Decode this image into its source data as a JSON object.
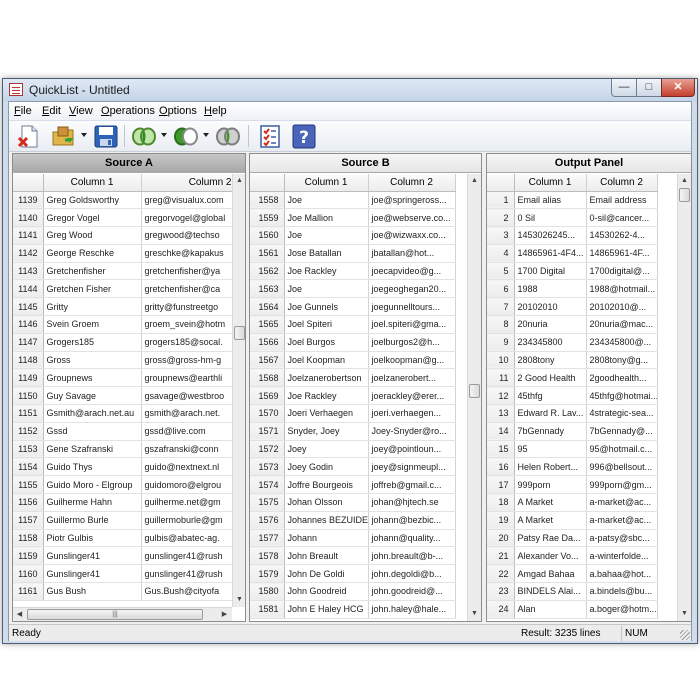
{
  "window": {
    "title": "QuickList - Untitled"
  },
  "menu": [
    {
      "pre": "",
      "u": "F",
      "post": "ile"
    },
    {
      "pre": "",
      "u": "E",
      "post": "dit"
    },
    {
      "pre": "",
      "u": "V",
      "post": "iew"
    },
    {
      "pre": "",
      "u": "O",
      "post": "perations"
    },
    {
      "pre": "",
      "u": "O",
      "post": "ptions"
    },
    {
      "pre": "",
      "u": "H",
      "post": "elp"
    }
  ],
  "toolbar": {
    "icons": [
      "clear-document-icon",
      "open-folder-icon",
      "save-icon",
      "intersect-icon",
      "difference-icon",
      "union-icon",
      "checklist-icon",
      "help-icon"
    ]
  },
  "source_a": {
    "title": "Source A",
    "columns": [
      "Column 1",
      "Column 2"
    ],
    "rows": [
      [
        "1139",
        "Greg Goldsworthy",
        "greg@visualux.com"
      ],
      [
        "1140",
        "Gregor Vogel",
        "gregorvogel@global"
      ],
      [
        "1141",
        "Greg Wood",
        "gregwood@techso"
      ],
      [
        "1142",
        "George Reschke",
        "greschke@kapakus"
      ],
      [
        "1143",
        "Gretchenfisher",
        "gretchenfisher@ya"
      ],
      [
        "1144",
        "Gretchen Fisher",
        "gretchenfisher@ca"
      ],
      [
        "1145",
        "Gritty",
        "gritty@funstreetgo"
      ],
      [
        "1146",
        "Svein Groem",
        "groem_svein@hotm"
      ],
      [
        "1147",
        "Grogers185",
        "grogers185@socal."
      ],
      [
        "1148",
        "Gross",
        "gross@gross-hm-g"
      ],
      [
        "1149",
        "Groupnews",
        "groupnews@earthli"
      ],
      [
        "1150",
        "Guy Savage",
        "gsavage@westbroo"
      ],
      [
        "1151",
        "Gsmith@arach.net.au",
        "gsmith@arach.net."
      ],
      [
        "1152",
        "Gssd",
        "gssd@live.com"
      ],
      [
        "1153",
        "Gene Szafranski",
        "gszafranski@conn"
      ],
      [
        "1154",
        "Guido Thys",
        "guido@nextnext.nl"
      ],
      [
        "1155",
        "Guido Moro - Elgroup",
        "guidomoro@elgrou"
      ],
      [
        "1156",
        "Guilherme Hahn",
        "guilherme.net@gm"
      ],
      [
        "1157",
        "Guillermo Burle",
        "guillermoburle@gm"
      ],
      [
        "1158",
        "Piotr Gulbis",
        "gulbis@abatec-ag."
      ],
      [
        "1159",
        "Gunslinger41",
        "gunslinger41@rush"
      ],
      [
        "1160",
        "Gunslinger41",
        "gunslinger41@rush"
      ],
      [
        "1161",
        "Gus Bush",
        "Gus.Bush@cityofa"
      ]
    ]
  },
  "source_b": {
    "title": "Source B",
    "columns": [
      "Column 1",
      "Column 2"
    ],
    "rows": [
      [
        "1558",
        "Joe",
        "joe@springeross..."
      ],
      [
        "1559",
        "Joe Mallion",
        "joe@webserve.co..."
      ],
      [
        "1560",
        "Joe",
        "joe@wizwaxx.co..."
      ],
      [
        "1561",
        "Jose Batallan",
        "jbatallan@hot..."
      ],
      [
        "1562",
        "Joe Rackley",
        "joecapvideo@g..."
      ],
      [
        "1563",
        "Joe",
        "joegeoghegan20..."
      ],
      [
        "1564",
        "Joe Gunnels",
        "joegunnelltours..."
      ],
      [
        "1565",
        "Joel Spiteri",
        "joel.spiteri@gma..."
      ],
      [
        "1566",
        "Joel Burgos",
        "joelburgos2@h..."
      ],
      [
        "1567",
        "Joel Koopman",
        "joelkoopman@g..."
      ],
      [
        "1568",
        "Joelzanerobertson",
        "joelzanerobert..."
      ],
      [
        "1569",
        "Joe Rackley",
        "joerackley@erer..."
      ],
      [
        "1570",
        "Joeri Verhaegen",
        "joeri.verhaegen..."
      ],
      [
        "1571",
        "Snyder, Joey",
        "Joey-Snyder@ro..."
      ],
      [
        "1572",
        "Joey",
        "joey@pointloun..."
      ],
      [
        "1573",
        "Joey Godin",
        "joey@signmeupl..."
      ],
      [
        "1574",
        "Joffre Bourgeois",
        "joffreb@gmail.c..."
      ],
      [
        "1575",
        "Johan Olsson",
        "johan@hjtech.se"
      ],
      [
        "1576",
        "Johannes BEZUIDE...",
        "johann@bezbic..."
      ],
      [
        "1577",
        "Johann",
        "johann@quality..."
      ],
      [
        "1578",
        "John Breault",
        "john.breault@b-..."
      ],
      [
        "1579",
        "John De Goldi",
        "john.degoldi@b..."
      ],
      [
        "1580",
        "John Goodreid",
        "john.goodreid@..."
      ],
      [
        "1581",
        "John E Haley HCG",
        "john.haley@hale..."
      ]
    ]
  },
  "output_panel": {
    "title": "Output Panel",
    "columns": [
      "Column 1",
      "Column 2"
    ],
    "rows": [
      [
        "1",
        "Email alias",
        "Email address"
      ],
      [
        "2",
        "0 Sil",
        "0-sil@cancer..."
      ],
      [
        "3",
        "1453026245...",
        "14530262-4..."
      ],
      [
        "4",
        "14865961-4F4...",
        "14865961-4F..."
      ],
      [
        "5",
        "1700 Digital",
        "1700digital@..."
      ],
      [
        "6",
        "1988",
        "1988@hotmail..."
      ],
      [
        "7",
        "20102010",
        "20102010@..."
      ],
      [
        "8",
        "20nuria",
        "20nuria@mac..."
      ],
      [
        "9",
        "234345800",
        "234345800@..."
      ],
      [
        "10",
        "2808tony",
        "2808tony@g..."
      ],
      [
        "11",
        "2 Good Health",
        "2goodhealth..."
      ],
      [
        "12",
        "45thfg",
        "45thfg@hotmai..."
      ],
      [
        "13",
        "Edward R. Lav...",
        "4strategic-sea..."
      ],
      [
        "14",
        "7bGennady",
        "7bGennady@..."
      ],
      [
        "15",
        "95",
        "95@hotmail.c..."
      ],
      [
        "16",
        "Helen Robert...",
        "996@bellsout..."
      ],
      [
        "17",
        "999porn",
        "999porn@gm..."
      ],
      [
        "18",
        "A Market",
        "a-market@ac..."
      ],
      [
        "19",
        "A Market",
        "a-market@ac..."
      ],
      [
        "20",
        "Patsy Rae Da...",
        "a-patsy@sbc..."
      ],
      [
        "21",
        "Alexander Vo...",
        "a-winterfolde..."
      ],
      [
        "22",
        "Amgad Bahaa",
        "a.bahaa@hot..."
      ],
      [
        "23",
        "BINDELS Alai...",
        "a.bindels@bu..."
      ],
      [
        "24",
        "Alan",
        "a.boger@hotm..."
      ]
    ]
  },
  "status": {
    "ready": "Ready",
    "result": "Result: 3235 lines",
    "num": "NUM"
  }
}
